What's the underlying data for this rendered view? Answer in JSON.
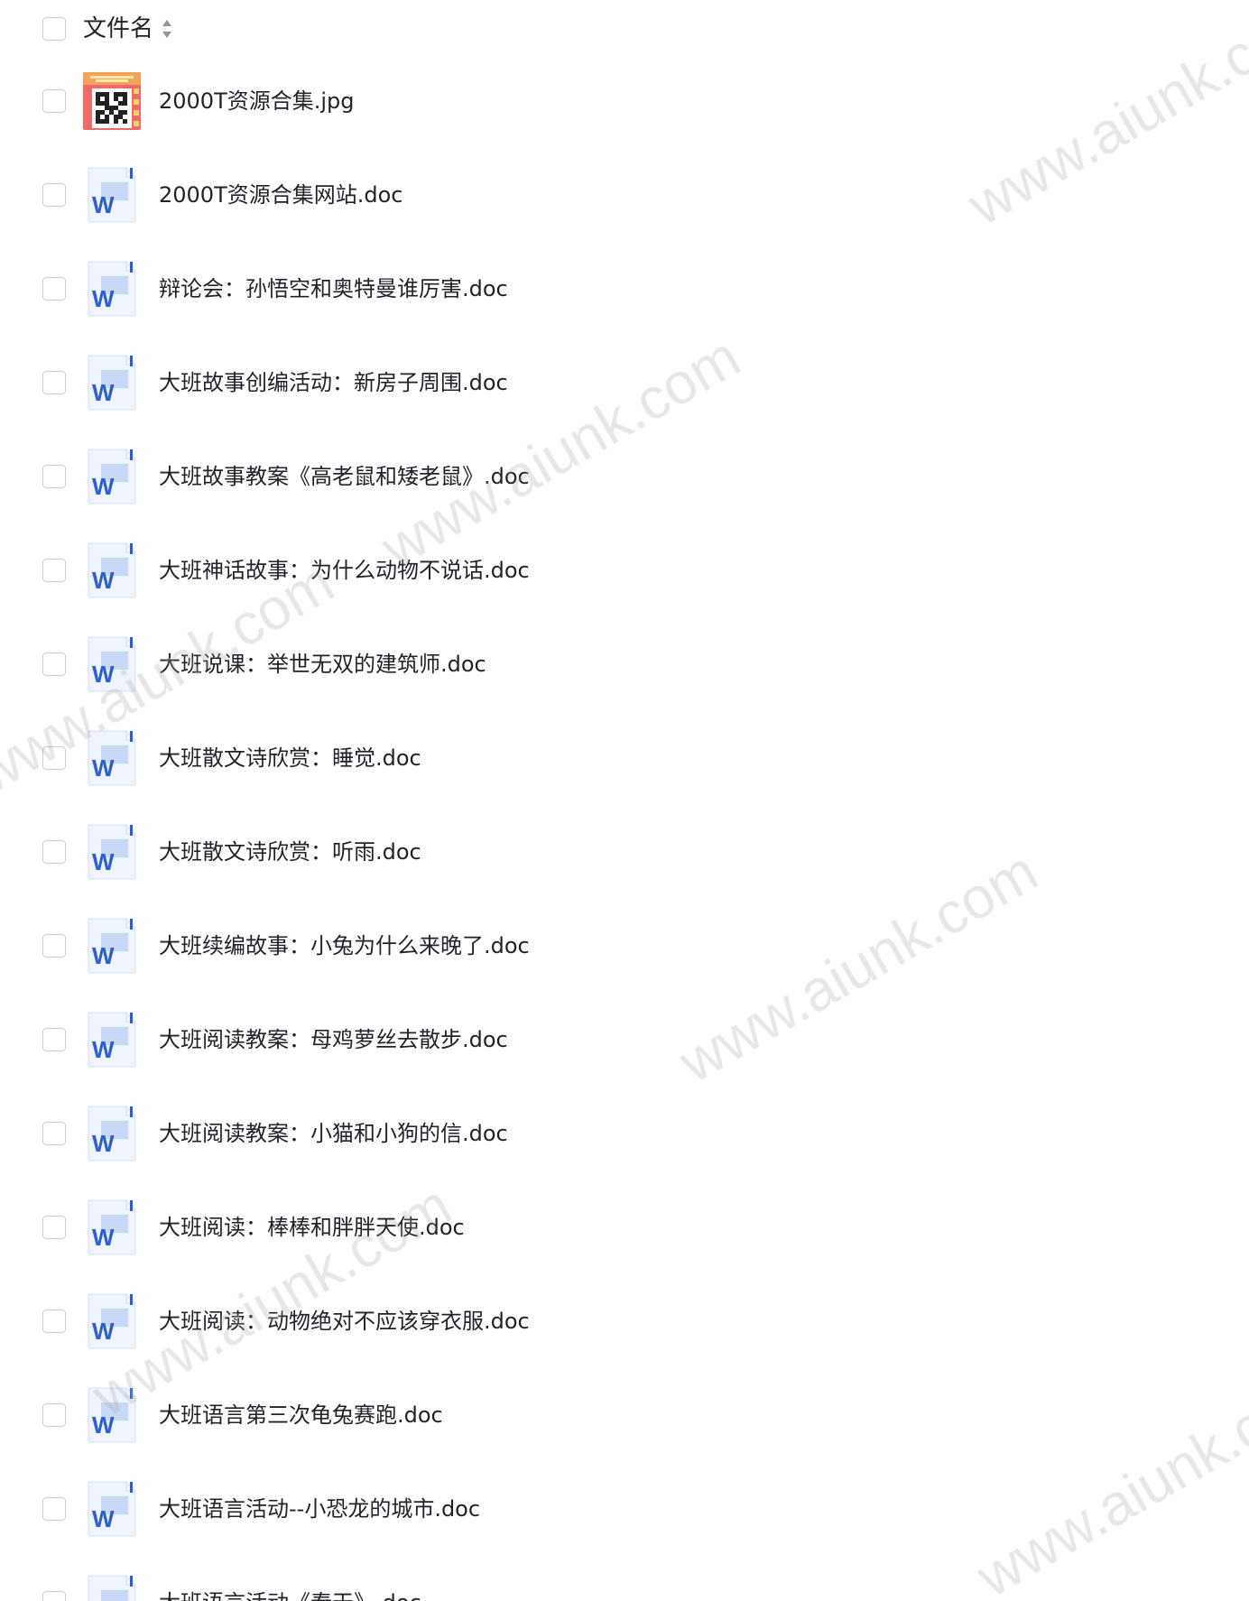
{
  "header": {
    "label": "文件名"
  },
  "files": [
    {
      "name": "2000T资源合集.jpg",
      "type": "jpg"
    },
    {
      "name": "2000T资源合集网站.doc",
      "type": "doc"
    },
    {
      "name": "辩论会：孙悟空和奥特曼谁厉害.doc",
      "type": "doc"
    },
    {
      "name": "大班故事创编活动：新房子周围.doc",
      "type": "doc"
    },
    {
      "name": "大班故事教案《高老鼠和矮老鼠》.doc",
      "type": "doc"
    },
    {
      "name": "大班神话故事：为什么动物不说话.doc",
      "type": "doc"
    },
    {
      "name": "大班说课：举世无双的建筑师.doc",
      "type": "doc"
    },
    {
      "name": "大班散文诗欣赏：睡觉.doc",
      "type": "doc"
    },
    {
      "name": "大班散文诗欣赏：听雨.doc",
      "type": "doc"
    },
    {
      "name": "大班续编故事：小兔为什么来晚了.doc",
      "type": "doc"
    },
    {
      "name": "大班阅读教案：母鸡萝丝去散步.doc",
      "type": "doc"
    },
    {
      "name": "大班阅读教案：小猫和小狗的信.doc",
      "type": "doc"
    },
    {
      "name": "大班阅读：棒棒和胖胖天使.doc",
      "type": "doc"
    },
    {
      "name": "大班阅读：动物绝对不应该穿衣服.doc",
      "type": "doc"
    },
    {
      "name": "大班语言第三次龟兔赛跑.doc",
      "type": "doc"
    },
    {
      "name": "大班语言活动--小恐龙的城市.doc",
      "type": "doc"
    },
    {
      "name": "大班语言活动《春天》.doc",
      "type": "doc"
    }
  ],
  "watermark": "www.aiunk.com",
  "colors": {
    "word_blue": "#2b5fd9",
    "doc_bg": "#eef3fc",
    "checkbox_border": "#c9ced6",
    "text": "#1f2329"
  }
}
